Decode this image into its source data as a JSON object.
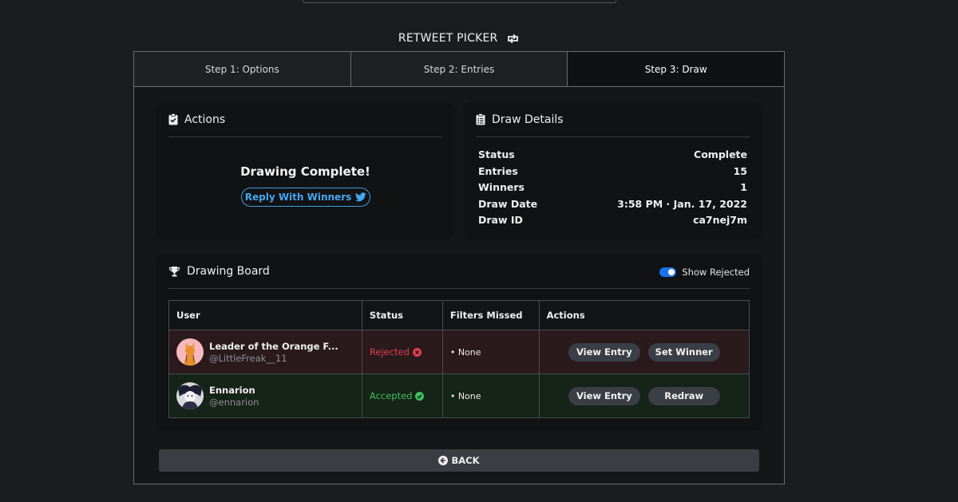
{
  "app": {
    "title": "RETWEET PICKER"
  },
  "tabs": [
    {
      "label": "Step 1: Options",
      "active": false
    },
    {
      "label": "Step 2: Entries",
      "active": false
    },
    {
      "label": "Step 3: Draw",
      "active": true
    }
  ],
  "actions": {
    "title": "Actions",
    "message": "Drawing Complete!",
    "reply_label": "Reply With Winners"
  },
  "details": {
    "title": "Draw Details",
    "rows": [
      {
        "label": "Status",
        "value": "Complete"
      },
      {
        "label": "Entries",
        "value": "15"
      },
      {
        "label": "Winners",
        "value": "1"
      },
      {
        "label": "Draw Date",
        "value": "3:58 PM · Jan. 17, 2022"
      },
      {
        "label": "Draw ID",
        "value": "ca7nej7m"
      }
    ]
  },
  "board": {
    "title": "Drawing Board",
    "toggle_label": "Show Rejected",
    "toggle_on": true,
    "columns": [
      "User",
      "Status",
      "Filters Missed",
      "Actions"
    ],
    "rows": [
      {
        "name": "Leader of the Orange F...",
        "handle": "@LittleFreak__11",
        "status": "Rejected",
        "filters": "• None",
        "action1": "View Entry",
        "action2": "Set Winner"
      },
      {
        "name": "Ennarion",
        "handle": "@ennarion",
        "status": "Accepted",
        "filters": "• None",
        "action1": "View Entry",
        "action2": "Redraw"
      }
    ]
  },
  "back_label": "BACK",
  "colors": {
    "accent": "#1a73e8",
    "rejected": "#e0404e",
    "accepted": "#3fbf5c",
    "link": "#46a6ee"
  },
  "icons": [
    "retweet-icon",
    "clipboard-check-icon",
    "clipboard-list-icon",
    "trophy-icon",
    "twitter-icon",
    "x-circle-icon",
    "check-circle-icon",
    "arrow-left-circle-icon"
  ]
}
